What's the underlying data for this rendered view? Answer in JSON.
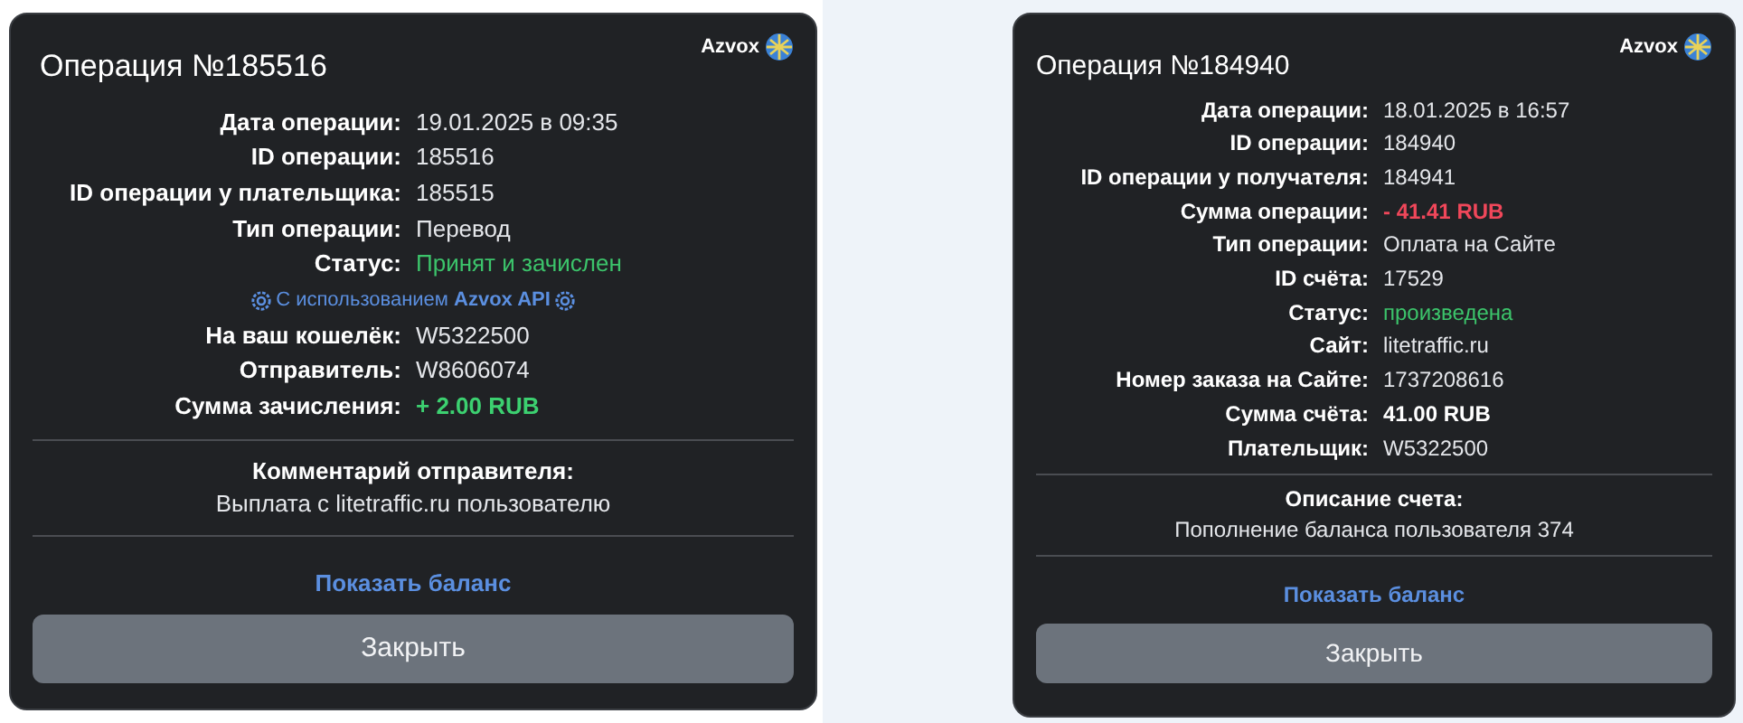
{
  "cards": [
    {
      "logo": "Azvox",
      "title": "Операция №185516",
      "details": [
        {
          "kind": "field",
          "label": "Дата операции:",
          "value": "19.01.2025 в 09:35",
          "color": "#e4e6ea",
          "bold": false
        },
        {
          "kind": "field",
          "label": "ID операции:",
          "value": "185516",
          "color": "#e4e6ea",
          "bold": false
        },
        {
          "kind": "field",
          "label": "ID операции у плательщика:",
          "value": "185515",
          "color": "#e4e6ea",
          "bold": false
        },
        {
          "kind": "field",
          "label": "Тип операции:",
          "value": "Перевод",
          "color": "#e4e6ea",
          "bold": false
        },
        {
          "kind": "field",
          "label": "Статус:",
          "value": "Принят и зачислен",
          "color": "#3cc46b",
          "bold": false
        },
        {
          "kind": "note",
          "value": "С использованием **Azvox API**"
        },
        {
          "kind": "field",
          "label": "На ваш кошелёк:",
          "value": "W5322500",
          "color": "#e4e6ea",
          "bold": false
        },
        {
          "kind": "field",
          "label": "Отправитель:",
          "value": "W8606074",
          "color": "#e4e6ea",
          "bold": false
        },
        {
          "kind": "field",
          "label": "Сумма зачисления:",
          "value": "+ 2.00 RUB",
          "color": "#3cd070",
          "bold": true
        }
      ],
      "comment": {
        "heading": "Комментарий отправителя:",
        "text": "Выплата с litetraffic.ru пользователю"
      },
      "link": "Показать баланс",
      "button": "Закрыть"
    },
    {
      "logo": "Azvox",
      "title": "Операция №184940",
      "details": [
        {
          "kind": "field",
          "label": "Дата операции:",
          "value": "18.01.2025 в 16:57",
          "color": "#e4e6ea",
          "bold": false
        },
        {
          "kind": "field",
          "label": "ID операции:",
          "value": "184940",
          "color": "#e4e6ea",
          "bold": false
        },
        {
          "kind": "field",
          "label": "ID операции у получателя:",
          "value": "184941",
          "color": "#e4e6ea",
          "bold": false
        },
        {
          "kind": "field",
          "label": "Сумма операции:",
          "value": "- 41.41 RUB",
          "color": "#f0475a",
          "bold": true
        },
        {
          "kind": "field",
          "label": "Тип операции:",
          "value": "Оплата на Сайте",
          "color": "#e4e6ea",
          "bold": false
        },
        {
          "kind": "field",
          "label": "ID счёта:",
          "value": "17529",
          "color": "#e4e6ea",
          "bold": false
        },
        {
          "kind": "field",
          "label": "Статус:",
          "value": "произведена",
          "color": "#3cc46b",
          "bold": false
        },
        {
          "kind": "field",
          "label": "Сайт:",
          "value": "litetraffic.ru",
          "color": "#e4e6ea",
          "bold": false
        },
        {
          "kind": "field",
          "label": "Номер заказа на Сайте:",
          "value": "1737208616",
          "color": "#e4e6ea",
          "bold": false
        },
        {
          "kind": "field",
          "label": "Сумма счёта:",
          "value": "41.00 RUB",
          "color": "#ffffff",
          "bold": true
        },
        {
          "kind": "field",
          "label": "Плательщик:",
          "value": "W5322500",
          "color": "#e4e6ea",
          "bold": false
        }
      ],
      "comment": {
        "heading": "Описание счета:",
        "text": "Пополнение баланса пользователя 374"
      },
      "link": "Показать баланс",
      "button": "Закрыть"
    }
  ]
}
